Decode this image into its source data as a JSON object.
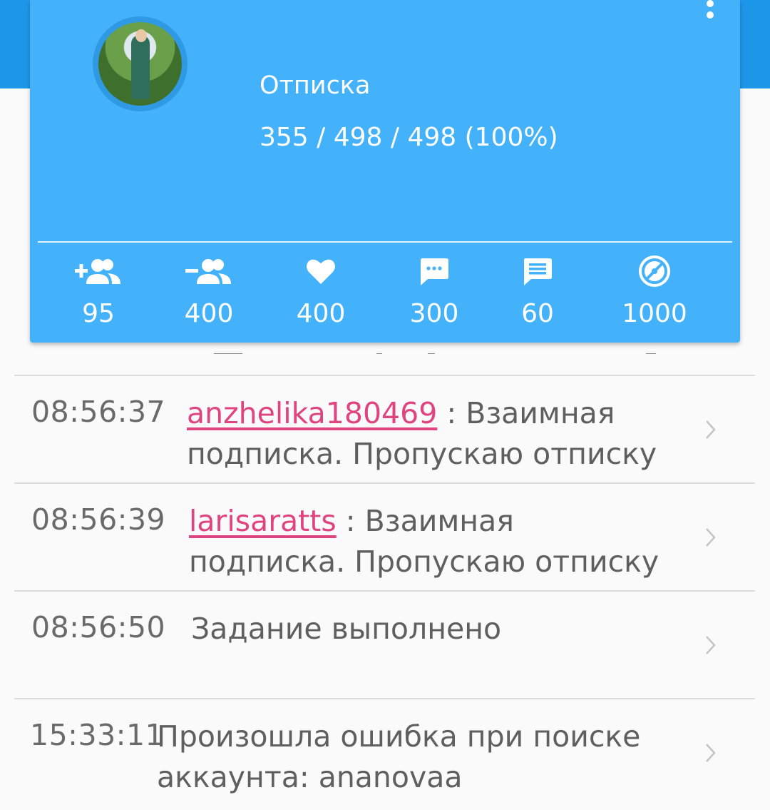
{
  "colors": {
    "header_bg": "#1e96e8",
    "card_bg": "#44b2fb",
    "username_link": "#e0447f",
    "text_secondary": "#5f5f5f"
  },
  "header": {
    "task_title": "Отписка",
    "progress": "355 / 498 / 498 (100%)",
    "menu_icon": "more-vert-icon",
    "stats": [
      {
        "icon": "add-friends-icon",
        "value": "95"
      },
      {
        "icon": "remove-friends-icon",
        "value": "400"
      },
      {
        "icon": "heart-icon",
        "value": "400"
      },
      {
        "icon": "comment-dots-icon",
        "value": "300"
      },
      {
        "icon": "message-lines-icon",
        "value": "60"
      },
      {
        "icon": "gauge-icon",
        "value": "1000"
      }
    ]
  },
  "log": [
    {
      "time": "08:56:37",
      "user": "anzhelika180469",
      "sep": " : ",
      "line1": "Взаимная",
      "line2": "подписка. Пропускаю отписку"
    },
    {
      "time": "08:56:39",
      "user": "larisaratts",
      "sep": " : ",
      "line1": "Взаимная",
      "line2": "подписка. Пропускаю отписку"
    },
    {
      "time": "08:56:50",
      "user": "",
      "sep": "",
      "line1": "Задание выполнено",
      "line2": ""
    },
    {
      "time": "15:33:11",
      "user": "",
      "sep": "",
      "line1": "Произошла ошибка при поиске",
      "line2": "аккаунта: ananovaa"
    }
  ]
}
